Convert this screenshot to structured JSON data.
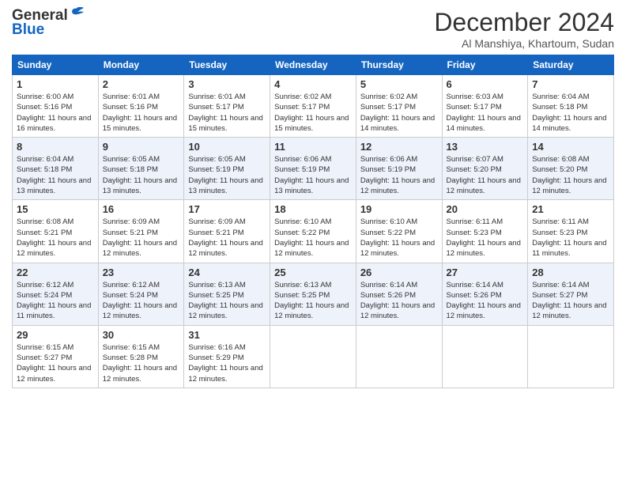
{
  "header": {
    "logo_line1": "General",
    "logo_line2": "Blue",
    "month_title": "December 2024",
    "location": "Al Manshiya, Khartoum, Sudan"
  },
  "weekdays": [
    "Sunday",
    "Monday",
    "Tuesday",
    "Wednesday",
    "Thursday",
    "Friday",
    "Saturday"
  ],
  "weeks": [
    [
      {
        "day": "1",
        "sunrise": "6:00 AM",
        "sunset": "5:16 PM",
        "daylight": "11 hours and 16 minutes."
      },
      {
        "day": "2",
        "sunrise": "6:01 AM",
        "sunset": "5:16 PM",
        "daylight": "11 hours and 15 minutes."
      },
      {
        "day": "3",
        "sunrise": "6:01 AM",
        "sunset": "5:17 PM",
        "daylight": "11 hours and 15 minutes."
      },
      {
        "day": "4",
        "sunrise": "6:02 AM",
        "sunset": "5:17 PM",
        "daylight": "11 hours and 15 minutes."
      },
      {
        "day": "5",
        "sunrise": "6:02 AM",
        "sunset": "5:17 PM",
        "daylight": "11 hours and 14 minutes."
      },
      {
        "day": "6",
        "sunrise": "6:03 AM",
        "sunset": "5:17 PM",
        "daylight": "11 hours and 14 minutes."
      },
      {
        "day": "7",
        "sunrise": "6:04 AM",
        "sunset": "5:18 PM",
        "daylight": "11 hours and 14 minutes."
      }
    ],
    [
      {
        "day": "8",
        "sunrise": "6:04 AM",
        "sunset": "5:18 PM",
        "daylight": "11 hours and 13 minutes."
      },
      {
        "day": "9",
        "sunrise": "6:05 AM",
        "sunset": "5:18 PM",
        "daylight": "11 hours and 13 minutes."
      },
      {
        "day": "10",
        "sunrise": "6:05 AM",
        "sunset": "5:19 PM",
        "daylight": "11 hours and 13 minutes."
      },
      {
        "day": "11",
        "sunrise": "6:06 AM",
        "sunset": "5:19 PM",
        "daylight": "11 hours and 13 minutes."
      },
      {
        "day": "12",
        "sunrise": "6:06 AM",
        "sunset": "5:19 PM",
        "daylight": "11 hours and 12 minutes."
      },
      {
        "day": "13",
        "sunrise": "6:07 AM",
        "sunset": "5:20 PM",
        "daylight": "11 hours and 12 minutes."
      },
      {
        "day": "14",
        "sunrise": "6:08 AM",
        "sunset": "5:20 PM",
        "daylight": "11 hours and 12 minutes."
      }
    ],
    [
      {
        "day": "15",
        "sunrise": "6:08 AM",
        "sunset": "5:21 PM",
        "daylight": "11 hours and 12 minutes."
      },
      {
        "day": "16",
        "sunrise": "6:09 AM",
        "sunset": "5:21 PM",
        "daylight": "11 hours and 12 minutes."
      },
      {
        "day": "17",
        "sunrise": "6:09 AM",
        "sunset": "5:21 PM",
        "daylight": "11 hours and 12 minutes."
      },
      {
        "day": "18",
        "sunrise": "6:10 AM",
        "sunset": "5:22 PM",
        "daylight": "11 hours and 12 minutes."
      },
      {
        "day": "19",
        "sunrise": "6:10 AM",
        "sunset": "5:22 PM",
        "daylight": "11 hours and 12 minutes."
      },
      {
        "day": "20",
        "sunrise": "6:11 AM",
        "sunset": "5:23 PM",
        "daylight": "11 hours and 12 minutes."
      },
      {
        "day": "21",
        "sunrise": "6:11 AM",
        "sunset": "5:23 PM",
        "daylight": "11 hours and 11 minutes."
      }
    ],
    [
      {
        "day": "22",
        "sunrise": "6:12 AM",
        "sunset": "5:24 PM",
        "daylight": "11 hours and 11 minutes."
      },
      {
        "day": "23",
        "sunrise": "6:12 AM",
        "sunset": "5:24 PM",
        "daylight": "11 hours and 12 minutes."
      },
      {
        "day": "24",
        "sunrise": "6:13 AM",
        "sunset": "5:25 PM",
        "daylight": "11 hours and 12 minutes."
      },
      {
        "day": "25",
        "sunrise": "6:13 AM",
        "sunset": "5:25 PM",
        "daylight": "11 hours and 12 minutes."
      },
      {
        "day": "26",
        "sunrise": "6:14 AM",
        "sunset": "5:26 PM",
        "daylight": "11 hours and 12 minutes."
      },
      {
        "day": "27",
        "sunrise": "6:14 AM",
        "sunset": "5:26 PM",
        "daylight": "11 hours and 12 minutes."
      },
      {
        "day": "28",
        "sunrise": "6:14 AM",
        "sunset": "5:27 PM",
        "daylight": "11 hours and 12 minutes."
      }
    ],
    [
      {
        "day": "29",
        "sunrise": "6:15 AM",
        "sunset": "5:27 PM",
        "daylight": "11 hours and 12 minutes."
      },
      {
        "day": "30",
        "sunrise": "6:15 AM",
        "sunset": "5:28 PM",
        "daylight": "11 hours and 12 minutes."
      },
      {
        "day": "31",
        "sunrise": "6:16 AM",
        "sunset": "5:29 PM",
        "daylight": "11 hours and 12 minutes."
      },
      null,
      null,
      null,
      null
    ]
  ],
  "labels": {
    "sunrise": "Sunrise:",
    "sunset": "Sunset:",
    "daylight": "Daylight:"
  }
}
